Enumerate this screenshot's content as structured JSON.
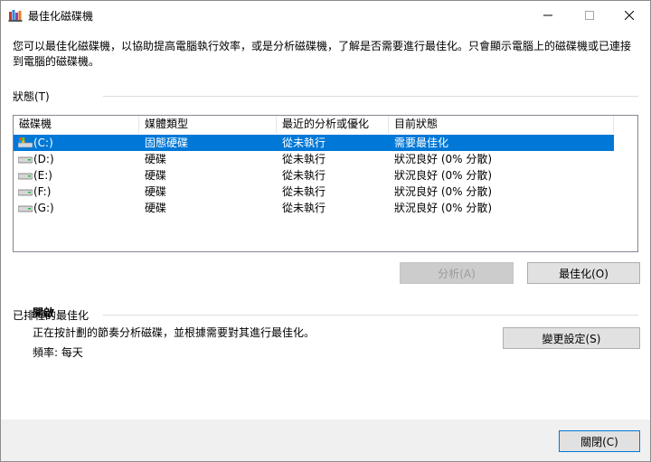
{
  "window": {
    "title": "最佳化磁碟機",
    "close_icon": "close-icon",
    "minimize_icon": "minimize-icon",
    "maximize_icon": "maximize-icon"
  },
  "description": "您可以最佳化磁碟機，以協助提高電腦執行效率，或是分析磁碟機，了解是否需要進行最佳化。只會顯示電腦上的磁碟機或已連接到電腦的磁碟機。",
  "status_section": {
    "label": "狀態(T)",
    "columns": [
      "磁碟機",
      "媒體類型",
      "最近的分析或優化",
      "目前狀態"
    ],
    "drives": [
      {
        "name": "(C:)",
        "media": "固態硬碟",
        "last": "從未執行",
        "status": "需要最佳化",
        "selected": true,
        "icon": "system-drive-icon"
      },
      {
        "name": "(D:)",
        "media": "硬碟",
        "last": "從未執行",
        "status": "狀況良好 (0% 分散)",
        "selected": false,
        "icon": "hard-drive-icon"
      },
      {
        "name": "(E:)",
        "media": "硬碟",
        "last": "從未執行",
        "status": "狀況良好 (0% 分散)",
        "selected": false,
        "icon": "hard-drive-icon"
      },
      {
        "name": "(F:)",
        "media": "硬碟",
        "last": "從未執行",
        "status": "狀況良好 (0% 分散)",
        "selected": false,
        "icon": "hard-drive-icon"
      },
      {
        "name": "(G:)",
        "media": "硬碟",
        "last": "從未執行",
        "status": "狀況良好 (0% 分散)",
        "selected": false,
        "icon": "hard-drive-icon"
      }
    ]
  },
  "buttons": {
    "analyze": "分析(A)",
    "optimize": "最佳化(O)",
    "change_settings": "變更設定(S)",
    "close": "關閉(C)"
  },
  "schedule_section": {
    "label": "已排程的最佳化",
    "state": "開啟",
    "description": "正在按計劃的節奏分析磁碟，並根據需要對其進行最佳化。",
    "frequency": "頻率: 每天"
  },
  "colors": {
    "selection": "#0078d7",
    "accent_border": "#0078d7"
  }
}
